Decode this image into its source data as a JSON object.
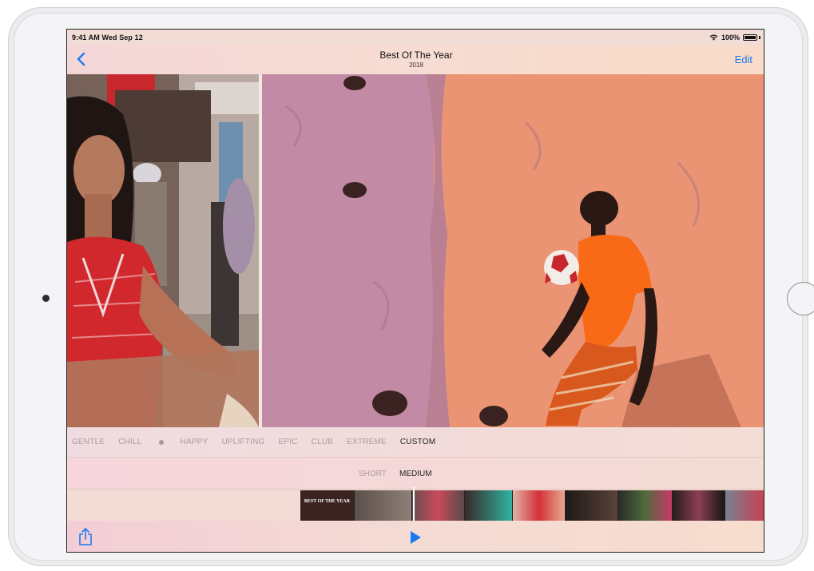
{
  "status_bar": {
    "time": "9:41 AM  Wed Sep 12",
    "battery": "100%"
  },
  "nav": {
    "title": "Best Of The Year",
    "subtitle": "2018",
    "edit_label": "Edit"
  },
  "moods": [
    "GENTLE",
    "CHILL",
    "HAPPY",
    "UPLIFTING",
    "EPIC",
    "CLUB",
    "EXTREME",
    "CUSTOM"
  ],
  "selected_mood": "CUSTOM",
  "lengths": [
    "SHORT",
    "MEDIUM"
  ],
  "selected_length": "MEDIUM",
  "filmstrip": {
    "first_frame_title": "BEST OF THE YEAR"
  },
  "icons": {
    "back": "chevron-left-icon",
    "wifi": "wifi-icon",
    "battery": "battery-icon",
    "share": "share-icon",
    "play": "play-icon"
  },
  "colors": {
    "accent": "#1a7bf0",
    "selected_text": "#222222",
    "unselected_text": "#a89a9c"
  }
}
